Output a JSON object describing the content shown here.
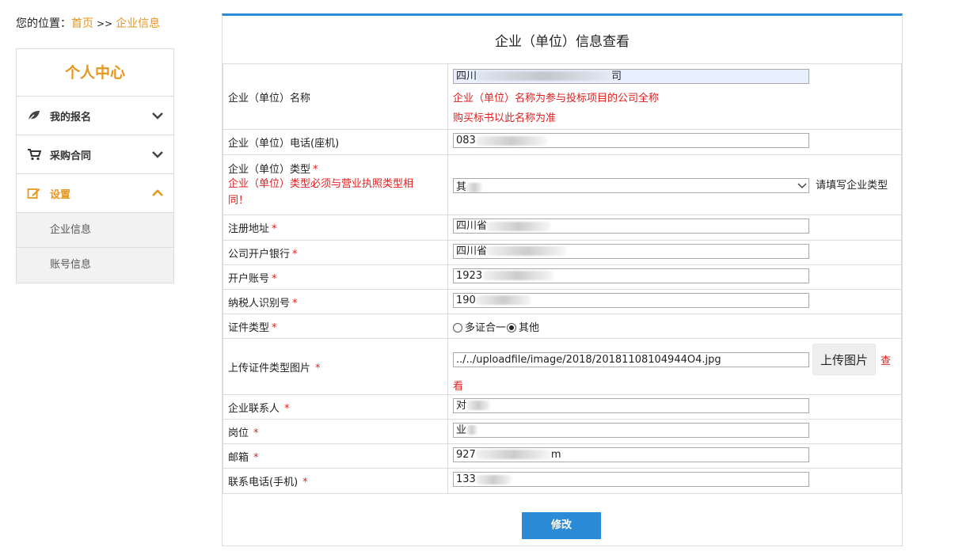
{
  "breadcrumb": {
    "prefix": "您的位置：",
    "home": "首页",
    "sep": ">>",
    "current": "企业信息"
  },
  "sidebar": {
    "title": "个人中心",
    "items": [
      {
        "label": "我的报名",
        "icon": "leaf-icon"
      },
      {
        "label": "采购合同",
        "icon": "cart-icon"
      },
      {
        "label": "设置",
        "icon": "edit-icon"
      }
    ],
    "subitems": [
      "企业信息",
      "账号信息"
    ]
  },
  "panel": {
    "title": "企业（单位）信息查看"
  },
  "form": {
    "company_name": {
      "label": "企业（单位）名称",
      "value": "四川",
      "value_suffix": "司",
      "hint1": "企业（单位）名称为参与投标项目的公司全称",
      "hint2": "购买标书以此名称为准"
    },
    "phone": {
      "label": "企业（单位）电话(座机)",
      "value": "083"
    },
    "type": {
      "label": "企业（单位）类型",
      "hint": "企业（单位）类型必须与营业执照类型相同！",
      "value": "其",
      "side_note": "请填写企业类型"
    },
    "address": {
      "label": "注册地址",
      "value": "四川省"
    },
    "bank": {
      "label": "公司开户银行",
      "value": "四川省"
    },
    "account": {
      "label": "开户账号",
      "value": "1923"
    },
    "taxid": {
      "label": "纳税人识别号",
      "value": "190"
    },
    "cert_type": {
      "label": "证件类型",
      "option1": "多证合一",
      "option2": "其他"
    },
    "cert_image": {
      "label": "上传证件类型图片",
      "value": "../../uploadfile/image/2018/20181108104944O4.jpg",
      "upload_label": "上传图片",
      "view_label1": "查",
      "view_label2": "看"
    },
    "contact": {
      "label": "企业联系人",
      "value": "对"
    },
    "position": {
      "label": "岗位",
      "value": "业"
    },
    "email": {
      "label": "邮箱",
      "value": "927",
      "value_suffix": "m"
    },
    "mobile": {
      "label": "联系电话(手机)",
      "value": "133"
    }
  },
  "actions": {
    "submit": "修改"
  },
  "colors": {
    "accent": "#e8961e",
    "primary": "#2b8bd6",
    "warning": "#e02020"
  }
}
